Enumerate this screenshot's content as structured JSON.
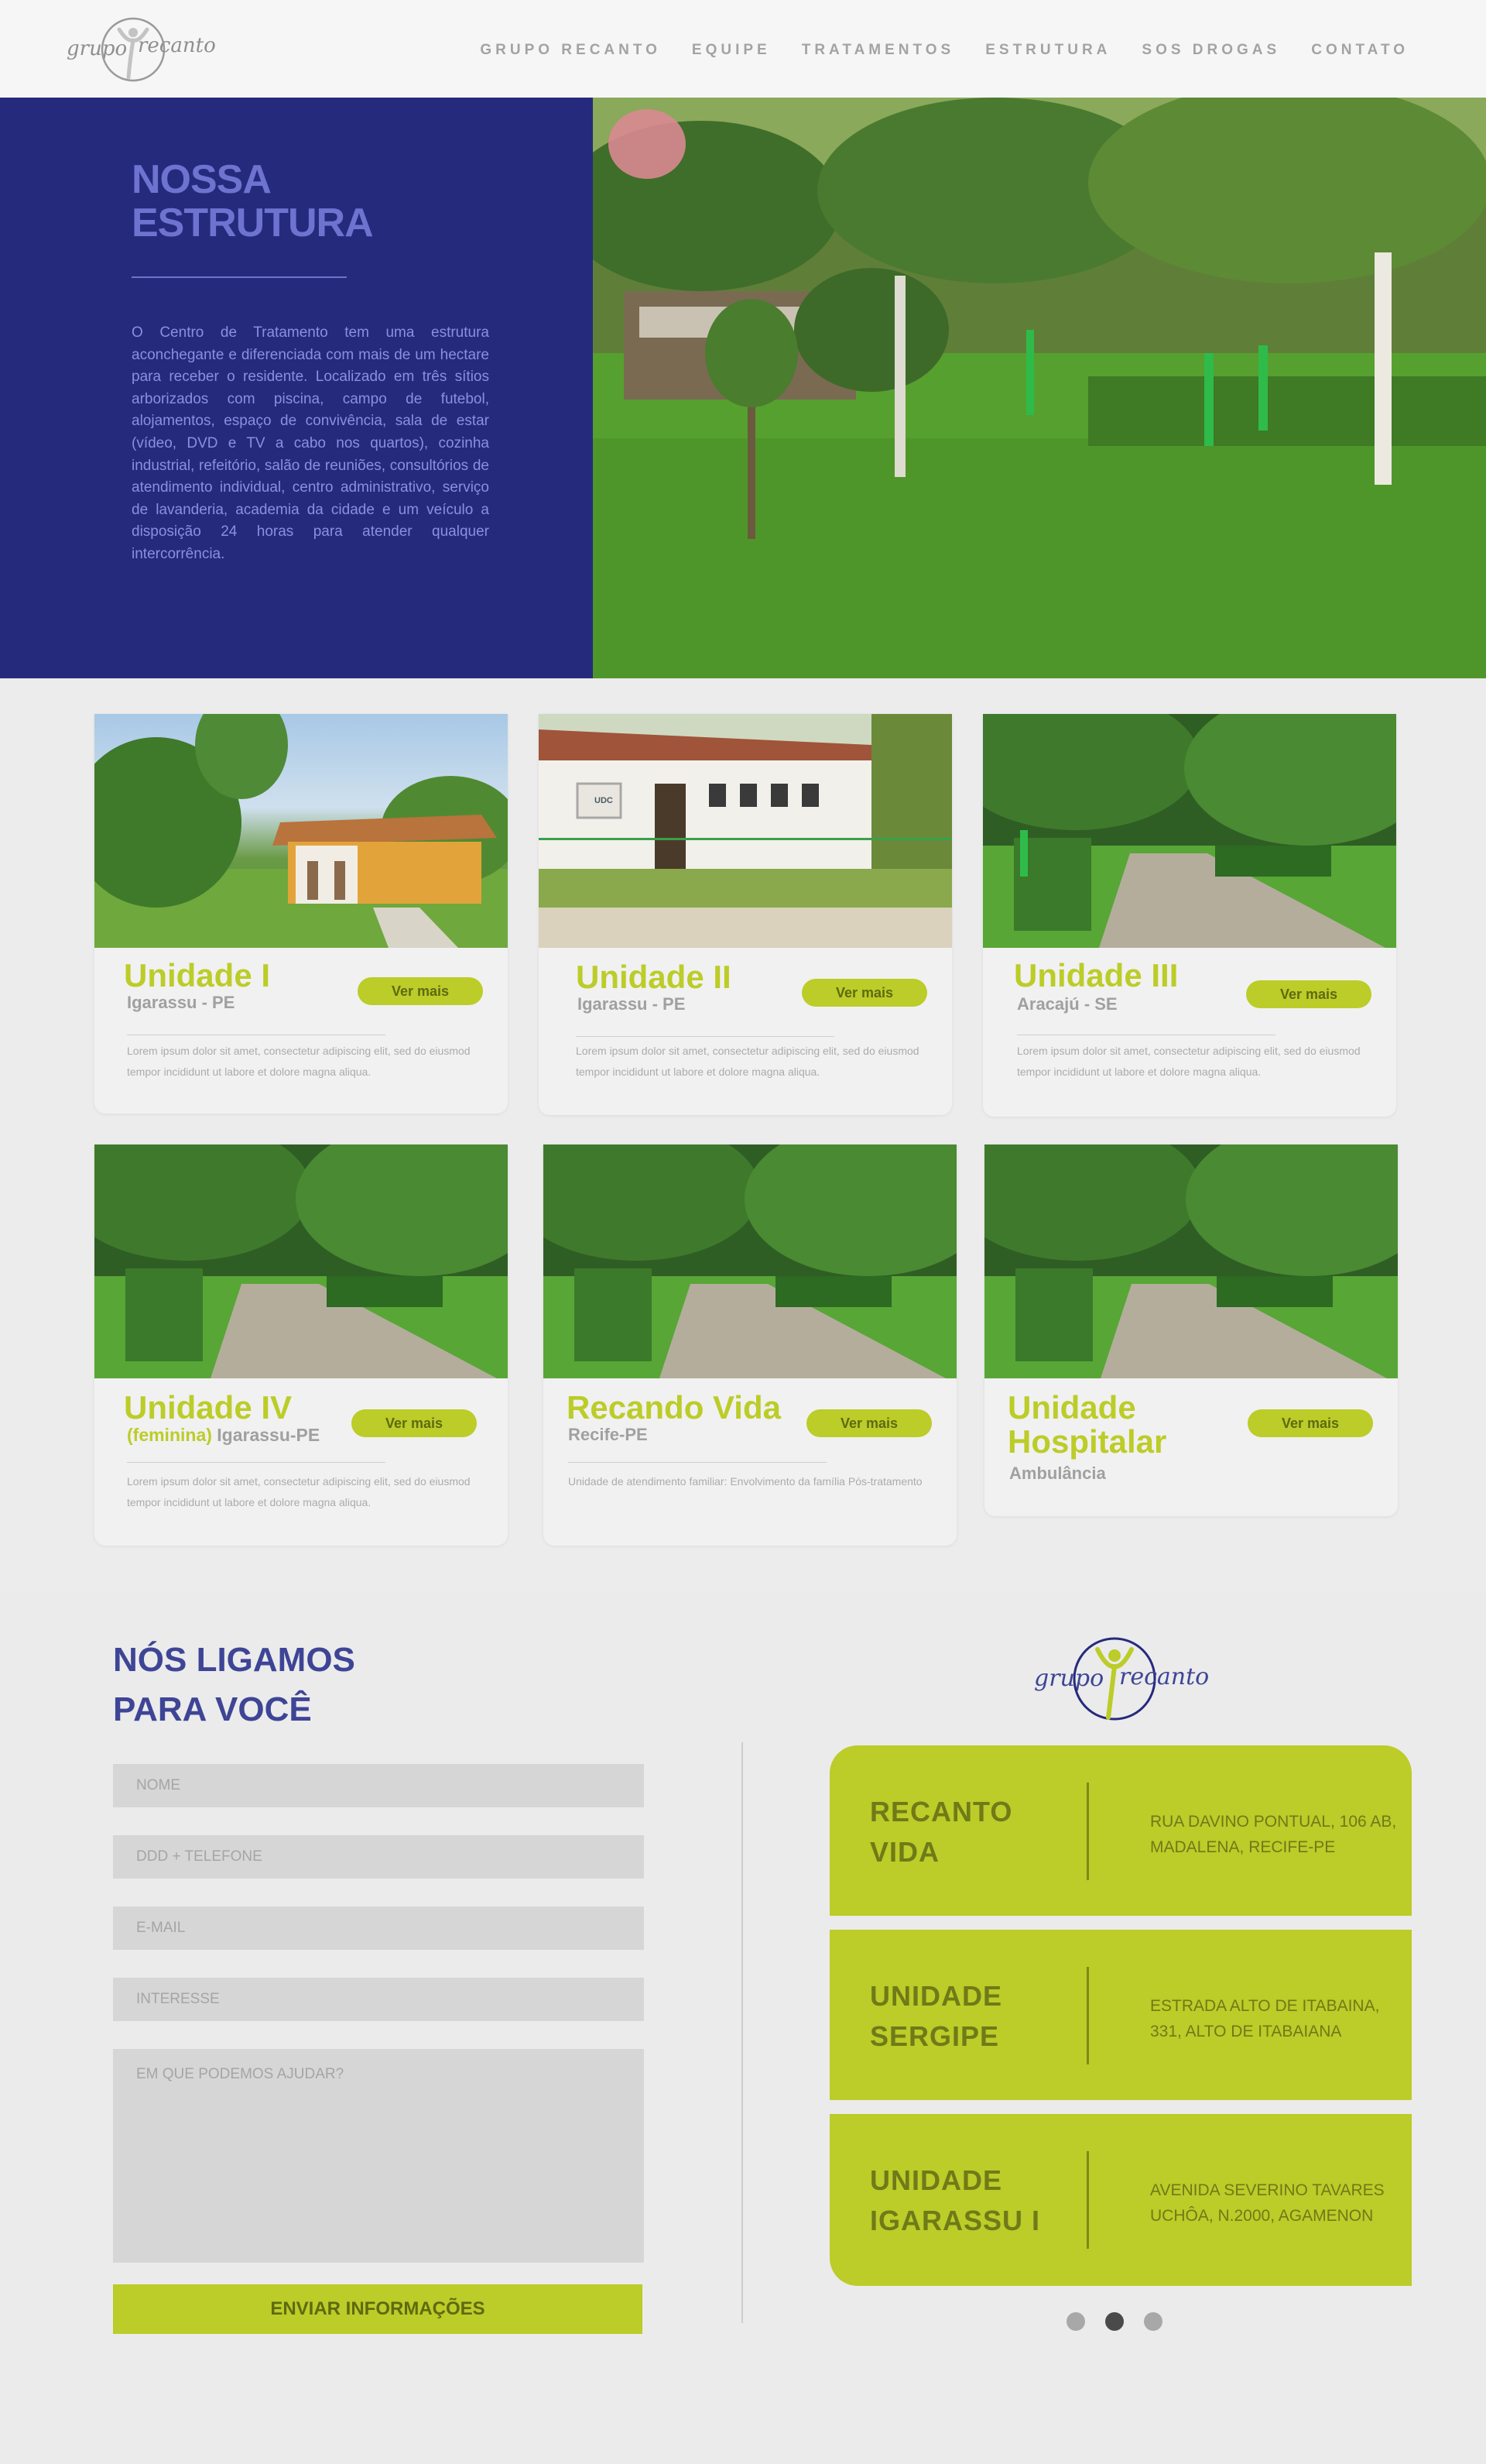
{
  "header": {
    "logo": {
      "word1": "grupo",
      "word2": "recanto",
      "icon": "person-arms-up-icon"
    },
    "nav": [
      "GRUPO RECANTO",
      "EQUIPE",
      "TRATAMENTOS",
      "ESTRUTURA",
      "SOS DROGAS",
      "CONTATO"
    ]
  },
  "hero": {
    "title": "NOSSA ESTRUTURA",
    "text": "O Centro de Tratamento tem uma estrutura aconchegante e diferenciada com mais de um hectare para receber o residente. Localizado em três sítios arborizados com piscina, campo de futebol, alojamentos, espaço de convivência, sala de estar (vídeo, DVD e TV a cabo nos quartos), cozinha industrial, refeitório, salão de reuniões, consultórios de atendimento individual, centro administrativo, serviço de lavanderia, academia da cidade e um veículo a disposição 24 horas para atender qualquer intercorrência.",
    "photo": "garden-palm-trees"
  },
  "units": [
    {
      "title": "Unidade I",
      "highlight": "",
      "sub": "Igarassu - PE",
      "button": "Ver mais",
      "desc": "Lorem ipsum dolor sit amet, consectetur adipiscing elit, sed do eiusmod tempor incididunt ut labore et dolore magna aliqua.",
      "photo": "house"
    },
    {
      "title": "Unidade II",
      "highlight": "",
      "sub": "Igarassu - PE",
      "button": "Ver mais",
      "desc": "Lorem ipsum dolor sit amet, consectetur adipiscing elit, sed do eiusmod tempor incididunt ut labore et dolore magna aliqua.",
      "photo": "udc-building",
      "sign": "UDC"
    },
    {
      "title": "Unidade III",
      "highlight": "",
      "sub": "Aracajú - SE",
      "button": "Ver mais",
      "desc": "Lorem ipsum dolor sit amet, consectetur adipiscing elit, sed do eiusmod tempor incididunt ut labore et dolore magna aliqua.",
      "photo": "garden-path"
    },
    {
      "title": "Unidade IV",
      "highlight": "(feminina)",
      "sub": "Igarassu-PE",
      "button": "Ver mais",
      "desc": "Lorem ipsum dolor sit amet, consectetur adipiscing elit, sed do eiusmod tempor incididunt ut labore et dolore magna aliqua.",
      "photo": "garden-path"
    },
    {
      "title": "Recando Vida",
      "highlight": "",
      "sub": "Recife-PE",
      "button": "Ver mais",
      "desc": "Unidade de atendimento familiar: Envolvimento da família Pós-tratamento",
      "photo": "garden-path"
    },
    {
      "title": "Unidade Hospitalar",
      "highlight": "",
      "sub": "Ambulância",
      "button": "Ver mais",
      "desc": "",
      "photo": "garden-path"
    }
  ],
  "contact": {
    "title": "NÓS LIGAMOS PARA VOCÊ",
    "fields": {
      "name": "NOME",
      "phone": "DDD + TELEFONE",
      "email": "E-MAIL",
      "interest": "INTERESSE",
      "message": "EM QUE PODEMOS AJUDAR?"
    },
    "submit": "ENVIAR INFORMAÇÕES",
    "addresses": [
      {
        "name": "RECANTO VIDA",
        "text": "RUA DAVINO PONTUAL, 106 AB, MADALENA, RECIFE-PE"
      },
      {
        "name": "UNIDADE SERGIPE",
        "text": "ESTRADA ALTO DE ITABAINA, 331, ALTO DE ITABAIANA"
      },
      {
        "name": "UNIDADE IGARASSU I",
        "text": "AVENIDA SEVERINO TAVARES UCHÔA, N.2000, AGAMENON"
      }
    ],
    "carousel": {
      "total": 3,
      "active": 2
    }
  },
  "colors": {
    "navy": "#262a7c",
    "lavender": "#6d73cf",
    "lime": "#bccc28",
    "olive": "#6f7a18"
  }
}
